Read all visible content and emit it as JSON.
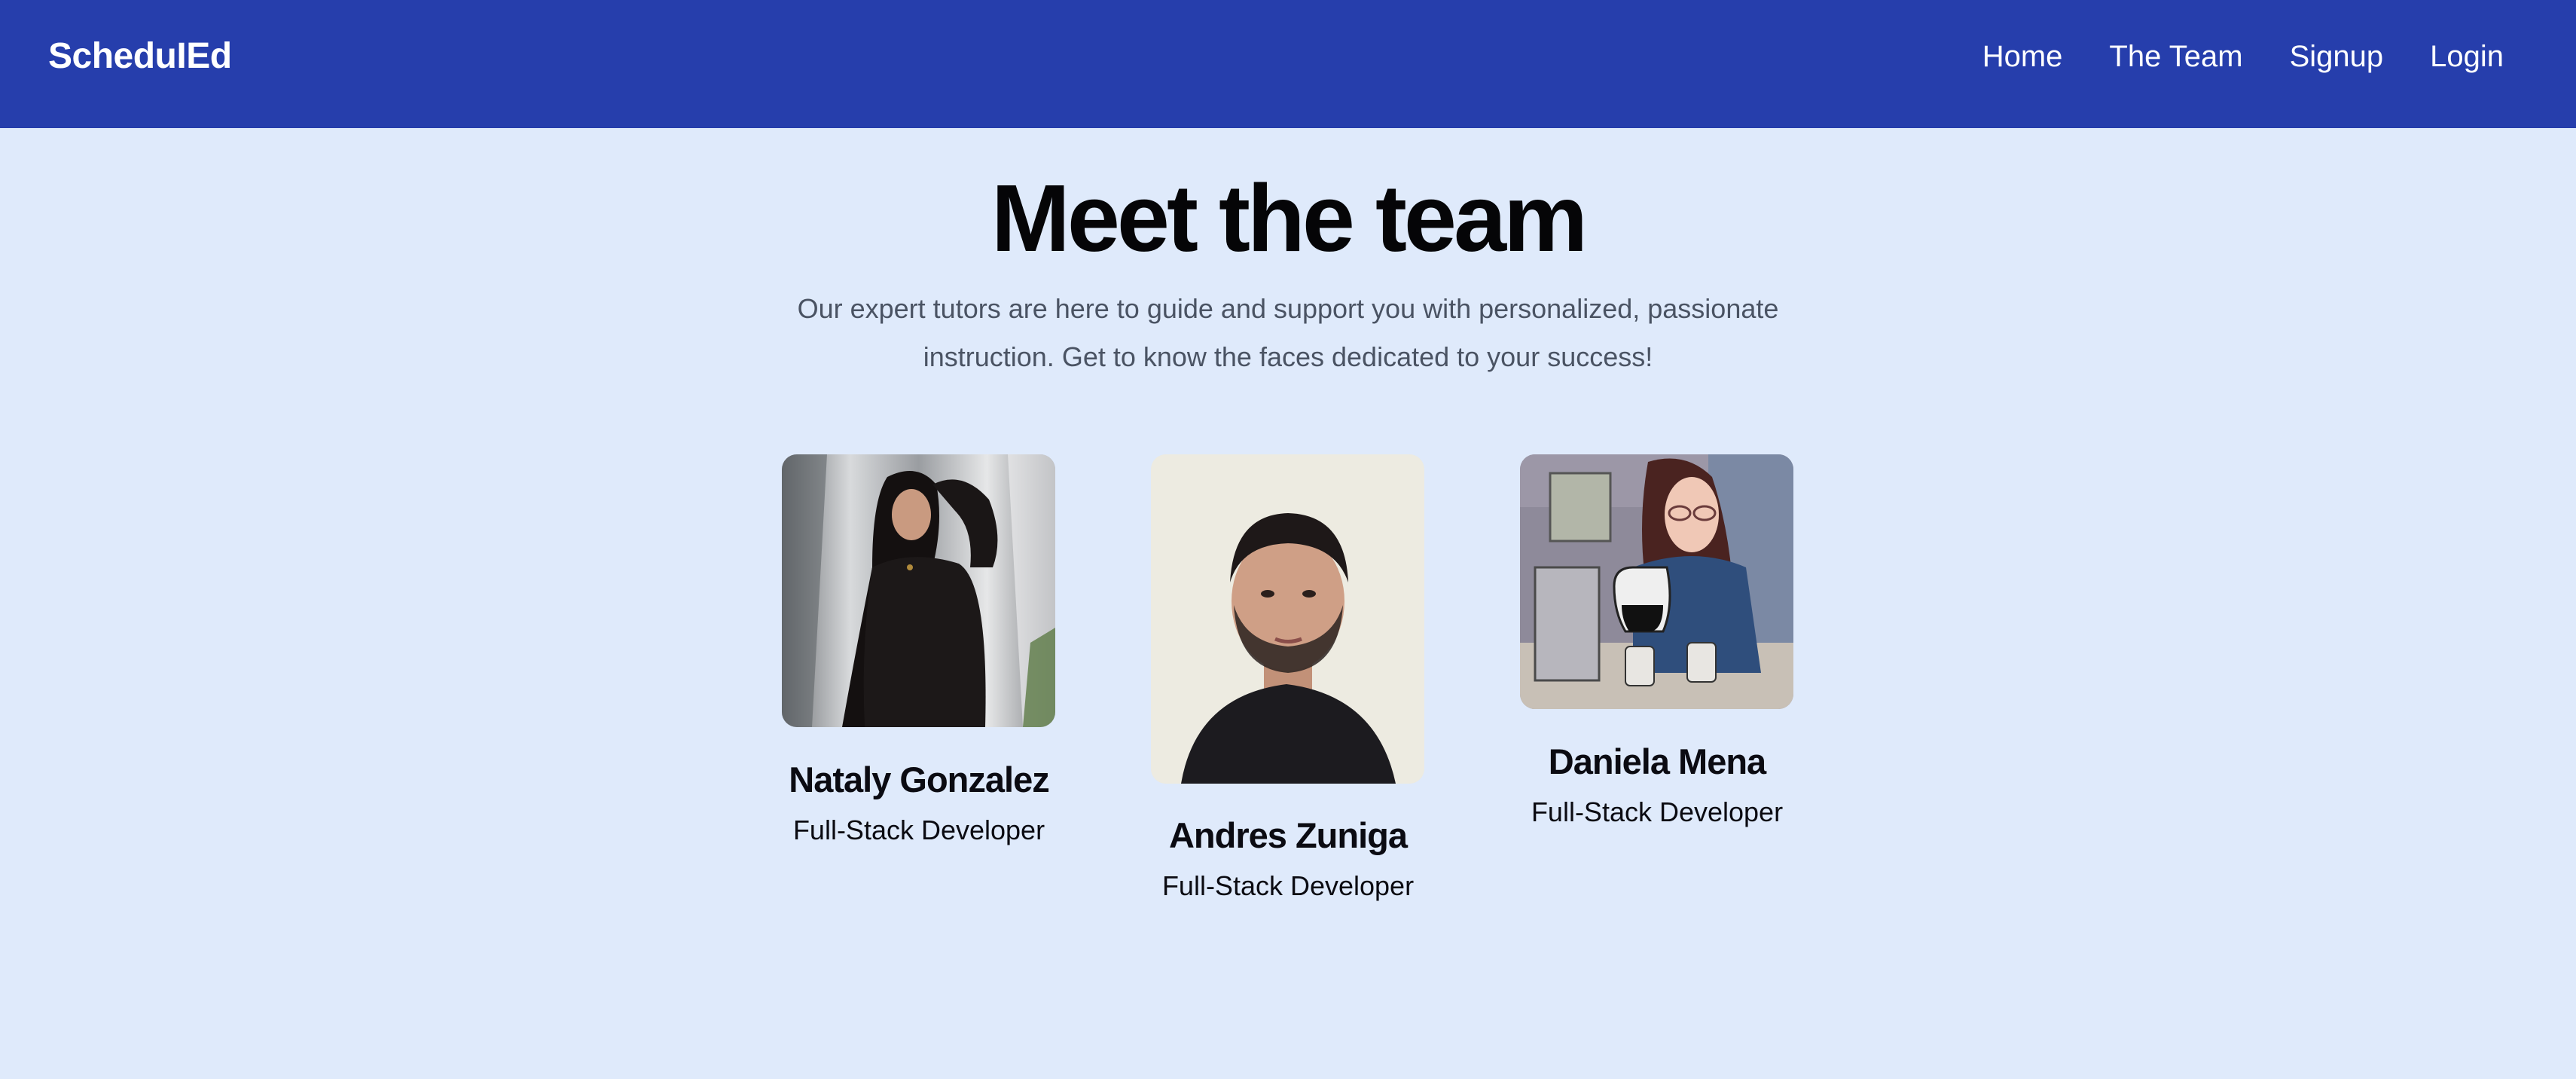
{
  "nav": {
    "brand": "ScheduIEd",
    "links": [
      "Home",
      "The Team",
      "Signup",
      "Login"
    ]
  },
  "hero": {
    "title": "Meet the team",
    "subtitle": "Our expert tutors are here to guide and support you with personalized, passionate instruction. Get to know the faces dedicated to your success!"
  },
  "team": [
    {
      "name": "Nataly Gonzalez",
      "role": "Full-Stack Developer",
      "photo": "waterfall-portrait"
    },
    {
      "name": "Andres Zuniga",
      "role": "Full-Stack Developer",
      "photo": "headshot-portrait"
    },
    {
      "name": "Daniela Mena",
      "role": "Full-Stack Developer",
      "photo": "cartoon-coffee"
    }
  ],
  "colors": {
    "nav_background": "#263eac",
    "page_background": "#dfeafb",
    "subtitle_text": "#4a5363"
  }
}
